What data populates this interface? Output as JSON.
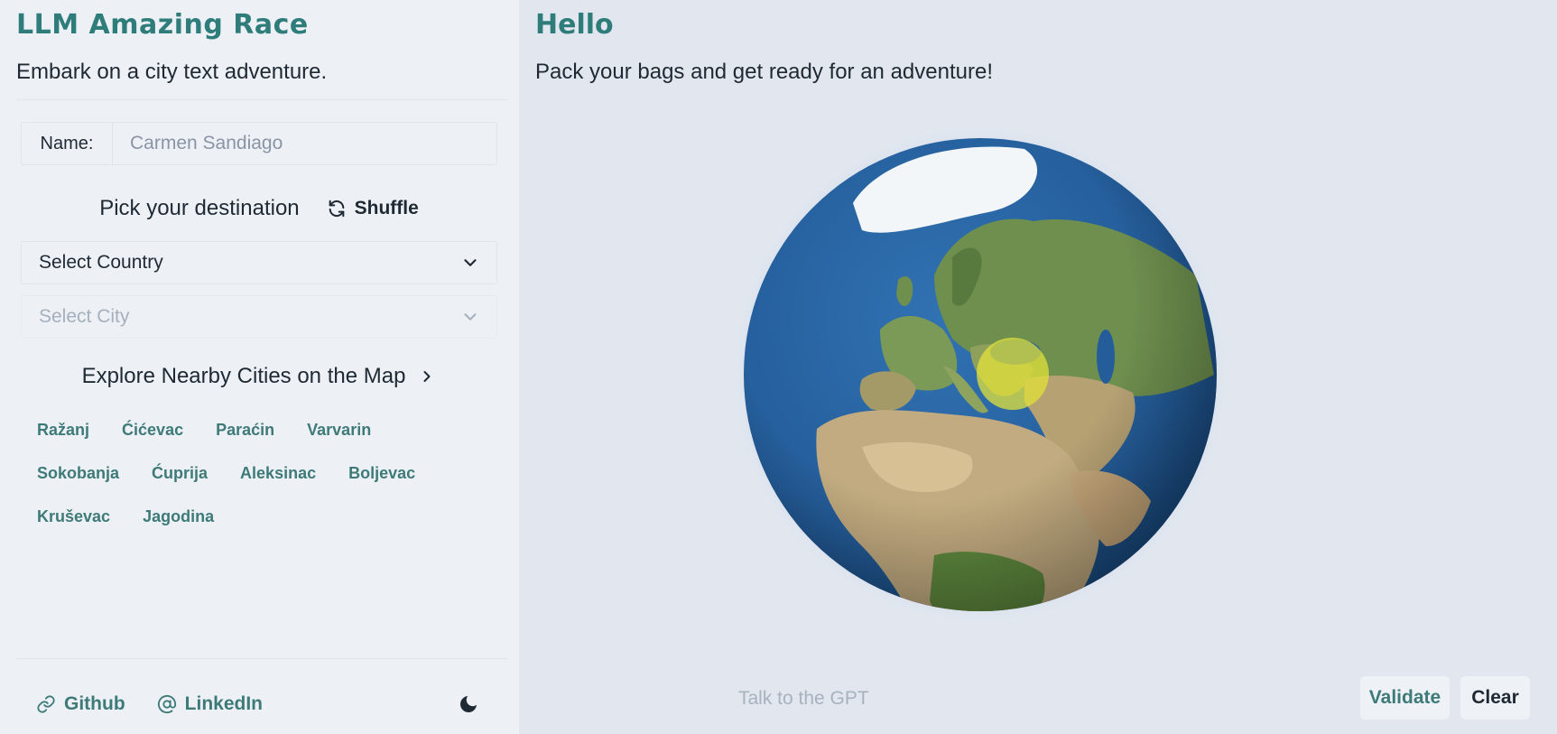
{
  "sidebar": {
    "title": "LLM Amazing Race",
    "subtitle": "Embark on a city text adventure.",
    "name_label": "Name:",
    "name_placeholder": "Carmen Sandiago",
    "pick_label": "Pick your destination",
    "shuffle_label": "Shuffle",
    "country_select": "Select Country",
    "city_select": "Select City",
    "explore_label": "Explore Nearby Cities on the Map",
    "nearby_cities": [
      "Ražanj",
      "Ćićevac",
      "Paraćin",
      "Varvarin",
      "Sokobanja",
      "Ćuprija",
      "Aleksinac",
      "Boljevac",
      "Kruševac",
      "Jagodina"
    ],
    "footer": {
      "github_label": "Github",
      "linkedin_label": "LinkedIn"
    }
  },
  "main": {
    "title": "Hello",
    "subtitle": "Pack your bags and get ready for an adventure!",
    "chat_placeholder": "Talk to the GPT",
    "validate_label": "Validate",
    "clear_label": "Clear"
  },
  "colors": {
    "accent": "#2f7d7b",
    "sidebar_bg": "#edf1f6",
    "main_bg": "#e2e7ef",
    "ocean": "#245d9a",
    "highlight": "#e1e23a"
  },
  "icons": {
    "shuffle": "refresh-icon",
    "chevron": "chevron-down-icon",
    "explore": "chevron-right-icon",
    "github": "link-icon",
    "linkedin": "at-icon",
    "theme": "moon-icon"
  }
}
